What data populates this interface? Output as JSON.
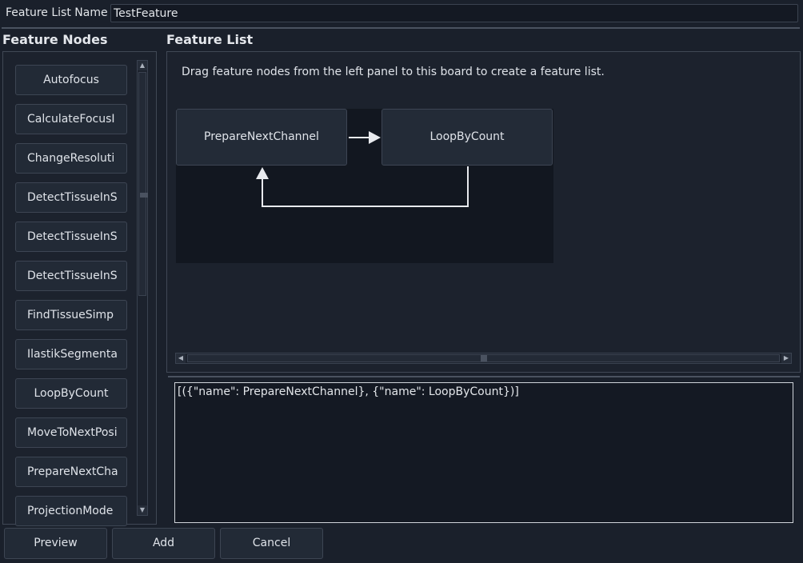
{
  "name_row": {
    "label": "Feature List Name",
    "value": "TestFeature"
  },
  "nodes_panel": {
    "title": "Feature Nodes",
    "items": [
      "Autofocus",
      "CalculateFocusI",
      "ChangeResoluti",
      "DetectTissueInS",
      "DetectTissueInS",
      "DetectTissueInS",
      "FindTissueSimp",
      "IlastikSegmenta",
      "LoopByCount",
      "MoveToNextPosi",
      "PrepareNextCha",
      "ProjectionMode"
    ]
  },
  "feature_list": {
    "title": "Feature List",
    "hint": "Drag feature nodes from the left panel to this board to create a feature list.",
    "flow_nodes": [
      "PrepareNextChannel",
      "LoopByCount"
    ]
  },
  "json_output": "[({\"name\": PrepareNextChannel}, {\"name\": LoopByCount})]",
  "buttons": {
    "preview": "Preview",
    "add": "Add",
    "cancel": "Cancel"
  },
  "icons": {
    "scroll_up": "arrow-up-icon",
    "scroll_down": "arrow-down-icon",
    "scroll_left": "arrow-left-icon",
    "scroll_right": "arrow-right-icon"
  },
  "colors": {
    "background": "#1a202b",
    "panel": "#1c222d",
    "canvas": "#121720",
    "button": "#222a36",
    "text": "#dfe3e9",
    "connector": "#e8eaee"
  }
}
